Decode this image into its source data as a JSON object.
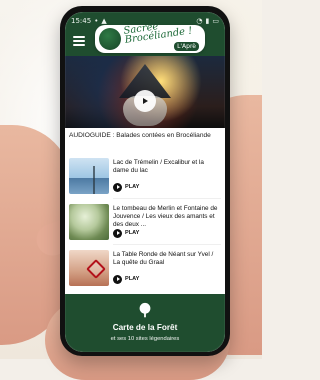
{
  "status_bar": {
    "time": "15:45",
    "left_icons": [
      "signal-dot-icon",
      "notification-icon"
    ],
    "right_icons": [
      "wifi-icon",
      "signal-icon",
      "battery-icon"
    ]
  },
  "header": {
    "logo_text": "Sacrée Brocéliande !",
    "logo_badge": "L'Aprè"
  },
  "hero": {
    "play_icon": "play-icon"
  },
  "audioguide": {
    "label": "AUDIOGUIDE : Balades contées en Brocéliande"
  },
  "items": [
    {
      "title": "Lac de Trémelin / Excalibur et la dame du lac",
      "play_label": "PLAY"
    },
    {
      "title": "Le tombeau de Merlin et Fontaine de Jouvence / Les vieux des amants et des deux ...",
      "play_label": "PLAY"
    },
    {
      "title": "La Table Ronde de Néant sur Yvel / La quête du Graal",
      "play_label": "PLAY"
    }
  ],
  "footer": {
    "title": "Carte de la Forêt",
    "subtitle": "et ses 10 sites légendaires",
    "icon": "tree-icon"
  },
  "colors": {
    "green": "#1f4d2f",
    "accent_red": "#b3121b"
  }
}
